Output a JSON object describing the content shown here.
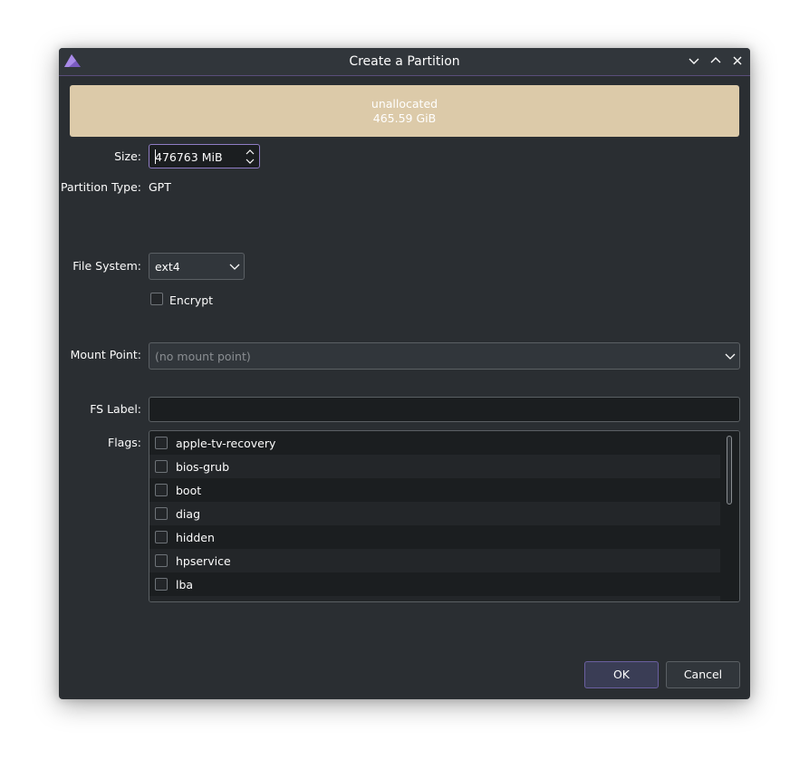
{
  "window": {
    "title": "Create a Partition"
  },
  "unallocated": {
    "name": "unallocated",
    "size": "465.59 GiB",
    "color": "#dccaa9"
  },
  "form": {
    "size_label": "Size:",
    "size_value": "476763 MiB",
    "partition_type_label": "Partition Type:",
    "partition_type_value": "GPT",
    "file_system_label": "File System:",
    "file_system_value": "ext4",
    "encrypt_label": "Encrypt",
    "mount_point_label": "Mount Point:",
    "mount_point_placeholder": "(no mount point)",
    "fs_label_label": "FS Label:",
    "fs_label_value": "",
    "flags_label": "Flags:"
  },
  "flags": [
    "apple-tv-recovery",
    "bios-grub",
    "boot",
    "diag",
    "hidden",
    "hpservice",
    "lba"
  ],
  "buttons": {
    "ok": "OK",
    "cancel": "Cancel"
  },
  "icons": {
    "app": "partitionmanager-icon",
    "minimize": "chevron-down-icon",
    "maximize": "chevron-up-icon",
    "close": "close-icon"
  },
  "colors": {
    "accent": "#8f7cc4",
    "window_bg": "#2a2e32",
    "input_bg": "#1b1e20"
  }
}
